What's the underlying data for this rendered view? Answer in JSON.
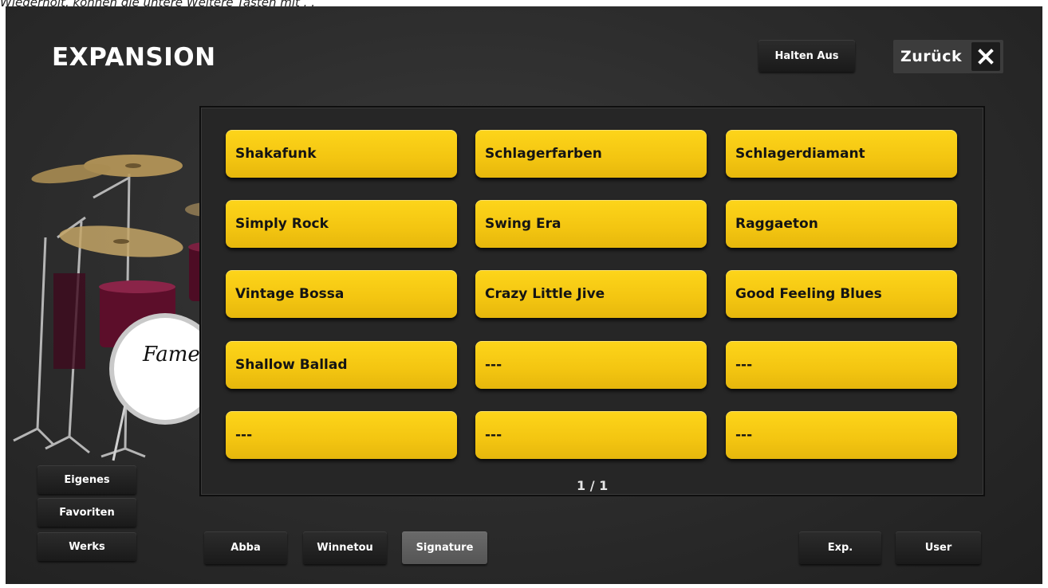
{
  "caption": "Wiederholt, können die untere Weitere Tasten mit . .",
  "title": "EXPANSION",
  "header": {
    "hold_label": "Halten Aus",
    "back_label": "Zurück",
    "close_icon": "close-icon"
  },
  "drum_logo": "Fame",
  "styles": [
    {
      "label": "Shakafunk"
    },
    {
      "label": "Schlagerfarben"
    },
    {
      "label": "Schlagerdiamant"
    },
    {
      "label": "Simply Rock"
    },
    {
      "label": "Swing Era"
    },
    {
      "label": "Raggaeton"
    },
    {
      "label": "Vintage Bossa"
    },
    {
      "label": "Crazy Little Jive"
    },
    {
      "label": "Good Feeling Blues"
    },
    {
      "label": "Shallow Ballad"
    },
    {
      "label": "---"
    },
    {
      "label": "---"
    },
    {
      "label": "---"
    },
    {
      "label": "---"
    },
    {
      "label": "---"
    }
  ],
  "pager": "1 / 1",
  "side_buttons": {
    "eigenes": "Eigenes",
    "favoriten": "Favoriten",
    "werks": "Werks"
  },
  "bottom_buttons": {
    "abba": "Abba",
    "winnetou": "Winnetou",
    "signature": "Signature",
    "exp": "Exp.",
    "user": "User"
  },
  "colors": {
    "tile_yellow": "#f3c511",
    "background": "#2b2b2b",
    "active_button": "#5f5f5f"
  }
}
